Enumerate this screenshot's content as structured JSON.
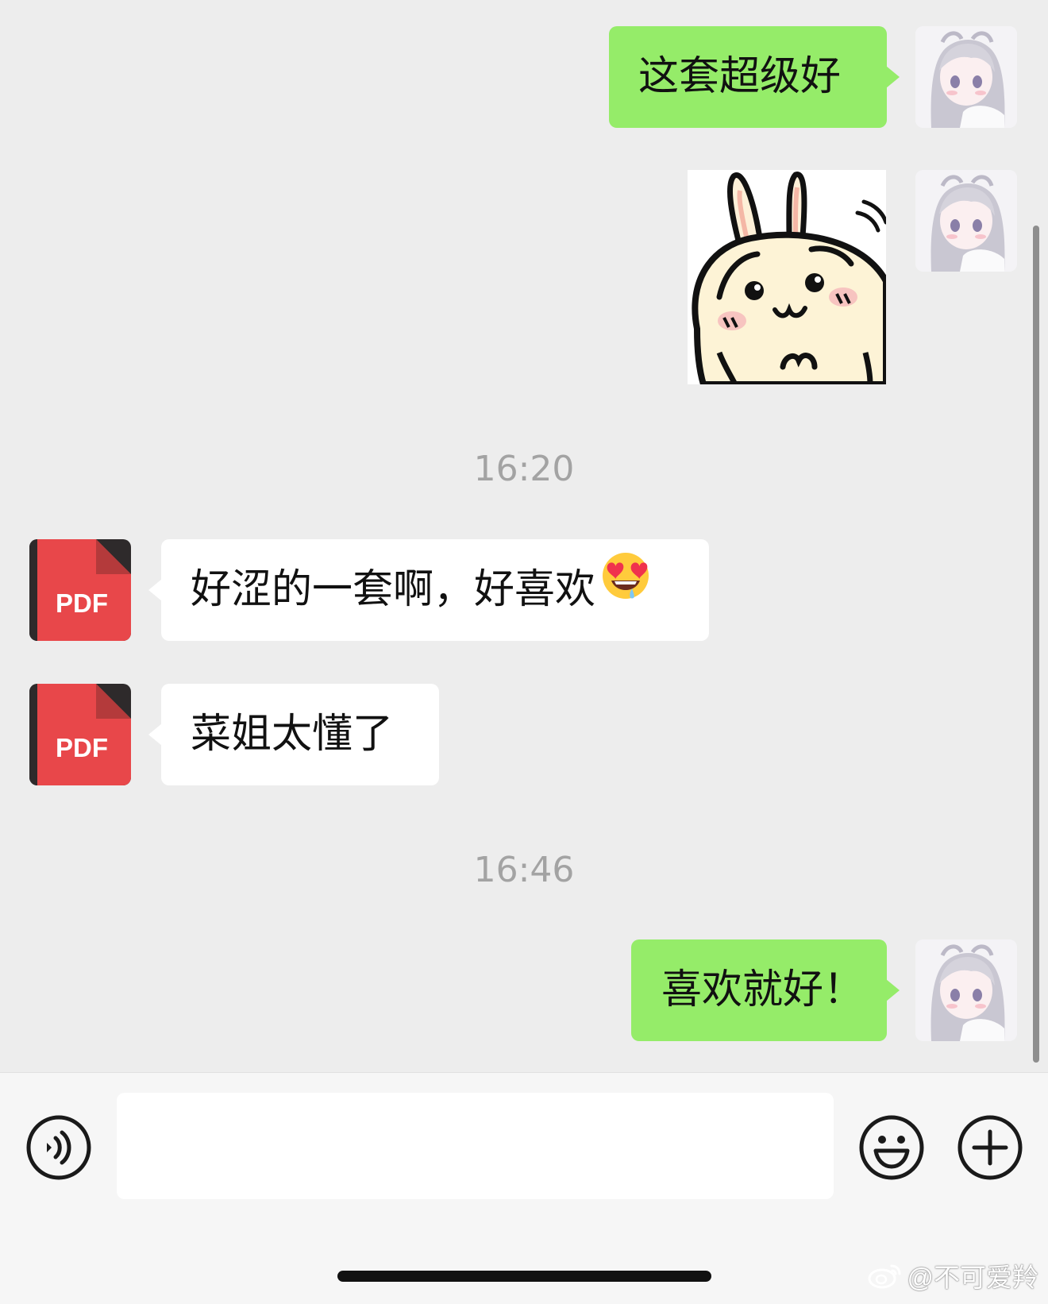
{
  "messages": [
    {
      "sender": "me",
      "text": "这套超级好"
    },
    {
      "sender": "me",
      "type": "sticker",
      "sticker": "rabbit-sticker"
    },
    {
      "sender": "them",
      "text": "好涩的一套啊，好喜欢"
    },
    {
      "sender": "them",
      "text": "菜姐太懂了"
    },
    {
      "sender": "me",
      "text": "喜欢就好！"
    }
  ],
  "timestamps": [
    "16:20",
    "16:46"
  ],
  "contact_avatar": {
    "label": "PDF",
    "color": "#e8474a"
  },
  "input": {
    "value": "",
    "placeholder": ""
  },
  "toolbar": {
    "voice_icon": "voice-icon",
    "emoji_icon": "emoji-icon",
    "plus_icon": "plus-icon"
  },
  "watermark": {
    "text": "@不可爱羚"
  },
  "colors": {
    "my_bubble": "#95ec69",
    "their_bubble": "#ffffff",
    "background": "#ededed"
  }
}
